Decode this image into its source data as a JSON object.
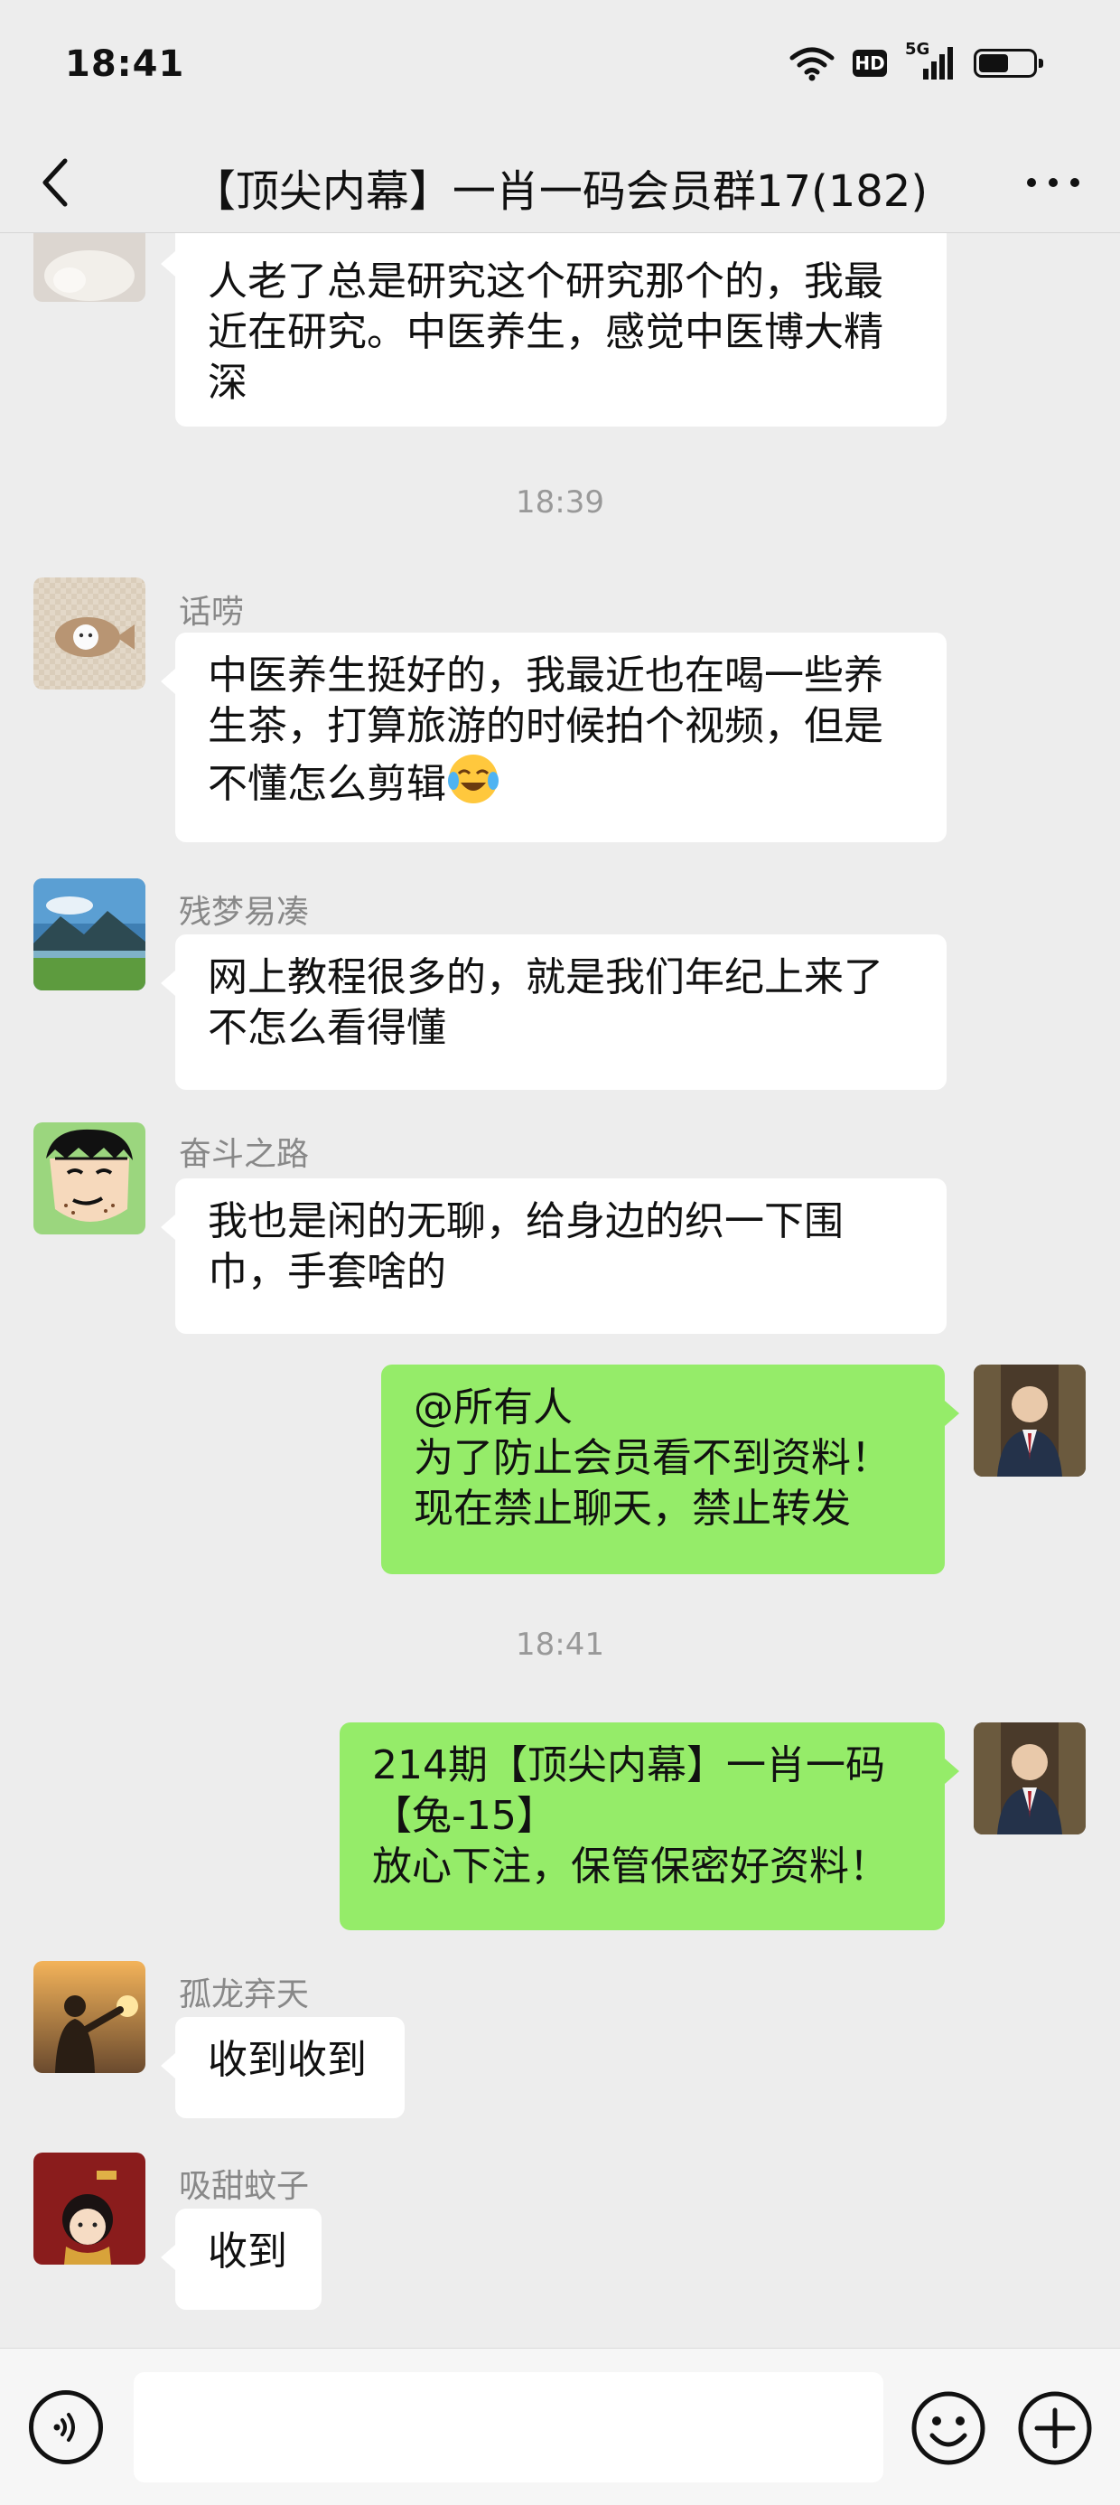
{
  "status": {
    "time": "18:41",
    "hd": "HD",
    "network": "5G",
    "battery_level": 0.55
  },
  "header": {
    "title": "【顶尖内幕】一肖一码会员群17(182)"
  },
  "messages": {
    "m0": {
      "lines": [
        "人老了总是研究这个研究那个的，我最",
        "近在研究。中医养生，感觉中医博大精",
        "深"
      ]
    },
    "ts1": "18:39",
    "m1": {
      "sender": "话唠",
      "lines": [
        "中医养生挺好的，我最近也在喝一些养",
        "生茶，打算旅游的时候拍个视频，但是",
        "不懂怎么剪辑"
      ]
    },
    "m2": {
      "sender": "残梦易凑",
      "lines": [
        "网上教程很多的，就是我们年纪上来了",
        "不怎么看得懂"
      ]
    },
    "m3": {
      "sender": "奋斗之路",
      "lines": [
        "我也是闲的无聊，给身边的织一下围",
        "巾，手套啥的"
      ]
    },
    "m4": {
      "lines": [
        "@所有人",
        "为了防止会员看不到资料！",
        "现在禁止聊天，禁止转发"
      ]
    },
    "ts2": "18:41",
    "m5": {
      "lines": [
        "214期【顶尖内幕】一肖一码",
        "【兔-15】",
        "放心下注，保管保密好资料！"
      ]
    },
    "m6": {
      "sender": "孤龙弃天",
      "lines": [
        "收到收到"
      ]
    },
    "m7": {
      "sender": "吸甜蚊子",
      "lines": [
        "收到"
      ]
    }
  },
  "colors": {
    "background": "#ededed",
    "bubble_self": "#95ec69",
    "bubble_other": "#ffffff",
    "meta_text": "#888888"
  },
  "icons": {
    "back": "chevron-left-icon",
    "more": "more-dots-icon",
    "voice": "voice-icon",
    "emoji": "emoji-icon",
    "plus": "plus-icon",
    "crying_laugh": "crying-laughing-emoji"
  }
}
